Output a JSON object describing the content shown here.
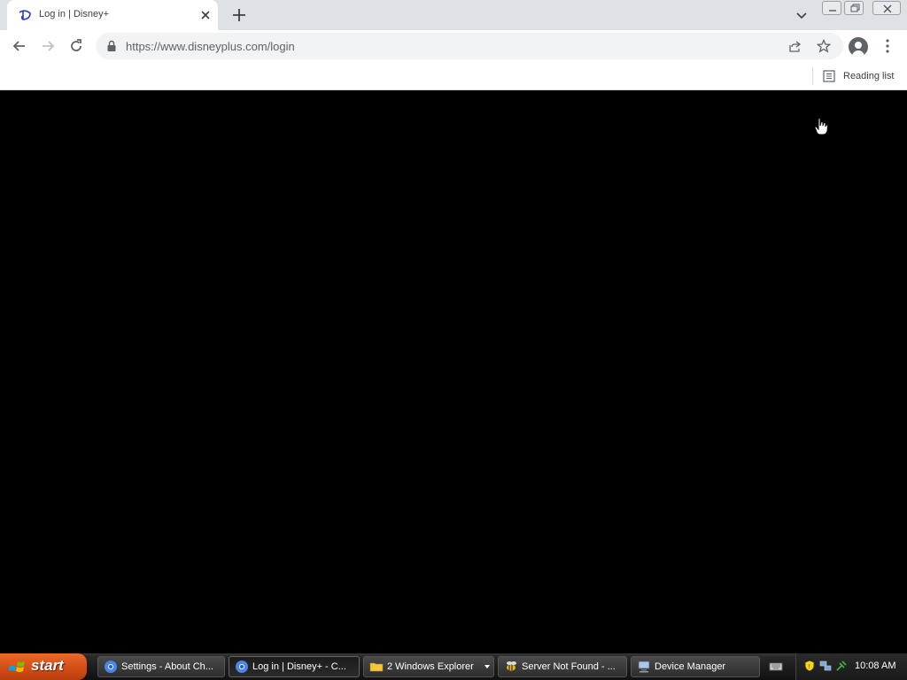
{
  "browser": {
    "tab": {
      "title": "Log in | Disney+"
    },
    "url": "https://www.disneyplus.com/login",
    "bookmarks_bar": {
      "reading_list_label": "Reading list"
    }
  },
  "taskbar": {
    "start_label": "start",
    "tasks": [
      {
        "label": "Settings - About Ch...",
        "icon": "chrome-icon",
        "active": false
      },
      {
        "label": "Log in | Disney+ - C...",
        "icon": "chrome-icon",
        "active": true
      },
      {
        "label": "2 Windows Explorer",
        "icon": "folder-icon",
        "active": false
      },
      {
        "label": "Server Not Found - ...",
        "icon": "bee-icon",
        "active": false
      },
      {
        "label": "Device Manager",
        "icon": "computer-icon",
        "active": false
      }
    ],
    "clock": "10:08 AM"
  },
  "colors": {
    "content_bg": "#000000",
    "tabstrip_bg": "#dee1e6",
    "start_orange": "#d8521a"
  }
}
